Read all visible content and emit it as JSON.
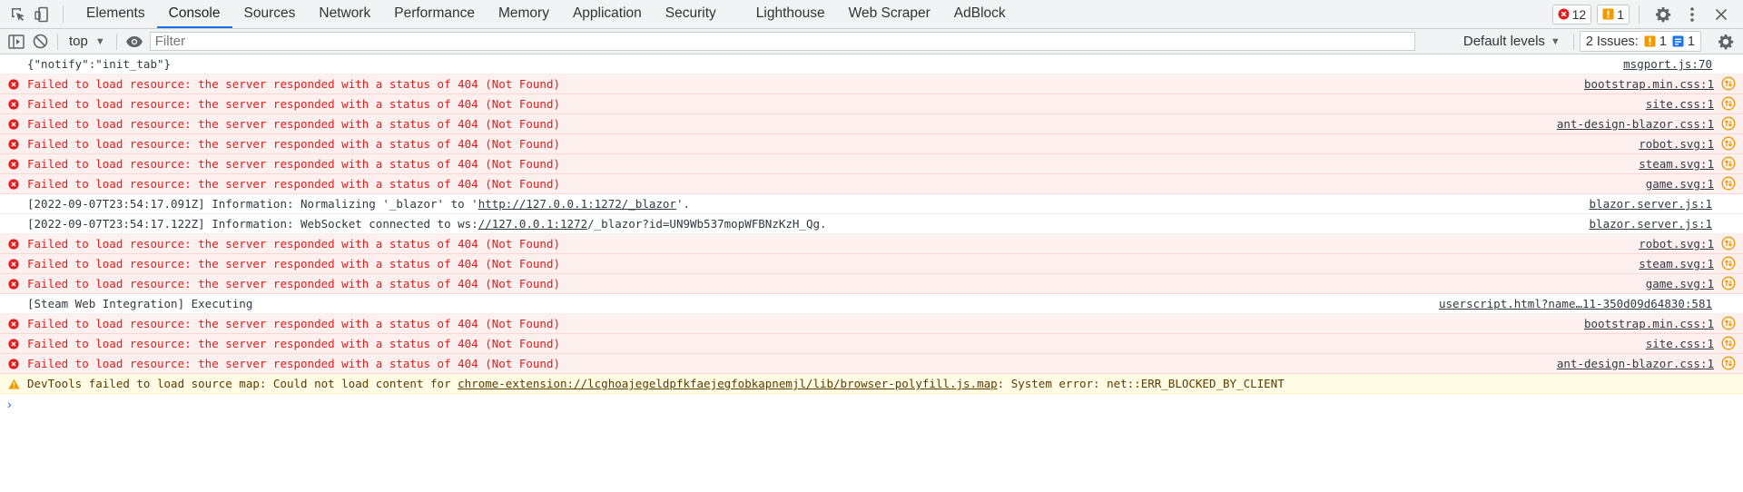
{
  "tabbar": {
    "tabs": [
      {
        "label": "Elements",
        "active": false
      },
      {
        "label": "Console",
        "active": true
      },
      {
        "label": "Sources",
        "active": false
      },
      {
        "label": "Network",
        "active": false
      },
      {
        "label": "Performance",
        "active": false
      },
      {
        "label": "Memory",
        "active": false
      },
      {
        "label": "Application",
        "active": false
      },
      {
        "label": "Security",
        "active": false
      },
      {
        "label": "Lighthouse",
        "active": false
      },
      {
        "label": "Web Scraper",
        "active": false
      },
      {
        "label": "AdBlock",
        "active": false
      }
    ],
    "error_count": "12",
    "warning_count": "1"
  },
  "toolbar": {
    "context": "top",
    "filter_placeholder": "Filter",
    "levels_label": "Default levels",
    "issues_label": "2 Issues:",
    "issues_warning": "1",
    "issues_info": "1"
  },
  "colors": {
    "error_red": "#e31b1b",
    "error_bg": "#fff0f0",
    "warn_bg": "#fffbe5",
    "accent_blue": "#1a73e8",
    "warn_orange": "#f29900"
  },
  "console": {
    "rows": [
      {
        "type": "info",
        "parts": [
          {
            "text": "{\"notify\":\"init_tab\"}"
          }
        ],
        "source": "msgport.js:70",
        "net": false
      },
      {
        "type": "error",
        "parts": [
          {
            "text": "Failed to load resource: the server responded with a status of 404 (Not Found)"
          }
        ],
        "source": "bootstrap.min.css:1",
        "net": true
      },
      {
        "type": "error",
        "parts": [
          {
            "text": "Failed to load resource: the server responded with a status of 404 (Not Found)"
          }
        ],
        "source": "site.css:1",
        "net": true
      },
      {
        "type": "error",
        "parts": [
          {
            "text": "Failed to load resource: the server responded with a status of 404 (Not Found)"
          }
        ],
        "source": "ant-design-blazor.css:1",
        "net": true
      },
      {
        "type": "error",
        "parts": [
          {
            "text": "Failed to load resource: the server responded with a status of 404 (Not Found)"
          }
        ],
        "source": "robot.svg:1",
        "net": true
      },
      {
        "type": "error",
        "parts": [
          {
            "text": "Failed to load resource: the server responded with a status of 404 (Not Found)"
          }
        ],
        "source": "steam.svg:1",
        "net": true
      },
      {
        "type": "error",
        "parts": [
          {
            "text": "Failed to load resource: the server responded with a status of 404 (Not Found)"
          }
        ],
        "source": "game.svg:1",
        "net": true
      },
      {
        "type": "info",
        "parts": [
          {
            "text": "[2022-09-07T23:54:17.091Z] Information: Normalizing '_blazor' to '"
          },
          {
            "text": "http://127.0.0.1:1272/_blazor",
            "link": true
          },
          {
            "text": "'."
          }
        ],
        "source": "blazor.server.js:1",
        "net": false
      },
      {
        "type": "info",
        "parts": [
          {
            "text": "[2022-09-07T23:54:17.122Z] Information: WebSocket connected to ws:"
          },
          {
            "text": "//127.0.0.1:1272",
            "link": true
          },
          {
            "text": "/_blazor?id=UN9Wb537mopWFBNzKzH_Qg."
          }
        ],
        "source": "blazor.server.js:1",
        "net": false
      },
      {
        "type": "error",
        "parts": [
          {
            "text": "Failed to load resource: the server responded with a status of 404 (Not Found)"
          }
        ],
        "source": "robot.svg:1",
        "net": true
      },
      {
        "type": "error",
        "parts": [
          {
            "text": "Failed to load resource: the server responded with a status of 404 (Not Found)"
          }
        ],
        "source": "steam.svg:1",
        "net": true
      },
      {
        "type": "error",
        "parts": [
          {
            "text": "Failed to load resource: the server responded with a status of 404 (Not Found)"
          }
        ],
        "source": "game.svg:1",
        "net": true
      },
      {
        "type": "info",
        "parts": [
          {
            "text": "[Steam Web Integration] Executing"
          }
        ],
        "source": "userscript.html?name…11-350d09d64830:581",
        "net": false
      },
      {
        "type": "error",
        "parts": [
          {
            "text": "Failed to load resource: the server responded with a status of 404 (Not Found)"
          }
        ],
        "source": "bootstrap.min.css:1",
        "net": true
      },
      {
        "type": "error",
        "parts": [
          {
            "text": "Failed to load resource: the server responded with a status of 404 (Not Found)"
          }
        ],
        "source": "site.css:1",
        "net": true
      },
      {
        "type": "error",
        "parts": [
          {
            "text": "Failed to load resource: the server responded with a status of 404 (Not Found)"
          }
        ],
        "source": "ant-design-blazor.css:1",
        "net": true
      },
      {
        "type": "warn",
        "parts": [
          {
            "text": "DevTools failed to load source map: Could not load content for "
          },
          {
            "text": "chrome-extension://lcghoajegeldpfkfaejegfobkapnemjl/lib/browser-polyfill.js.map",
            "link": true
          },
          {
            "text": ": System error: net::ERR_BLOCKED_BY_CLIENT"
          }
        ],
        "source": "",
        "net": false
      }
    ],
    "prompt": "›"
  }
}
